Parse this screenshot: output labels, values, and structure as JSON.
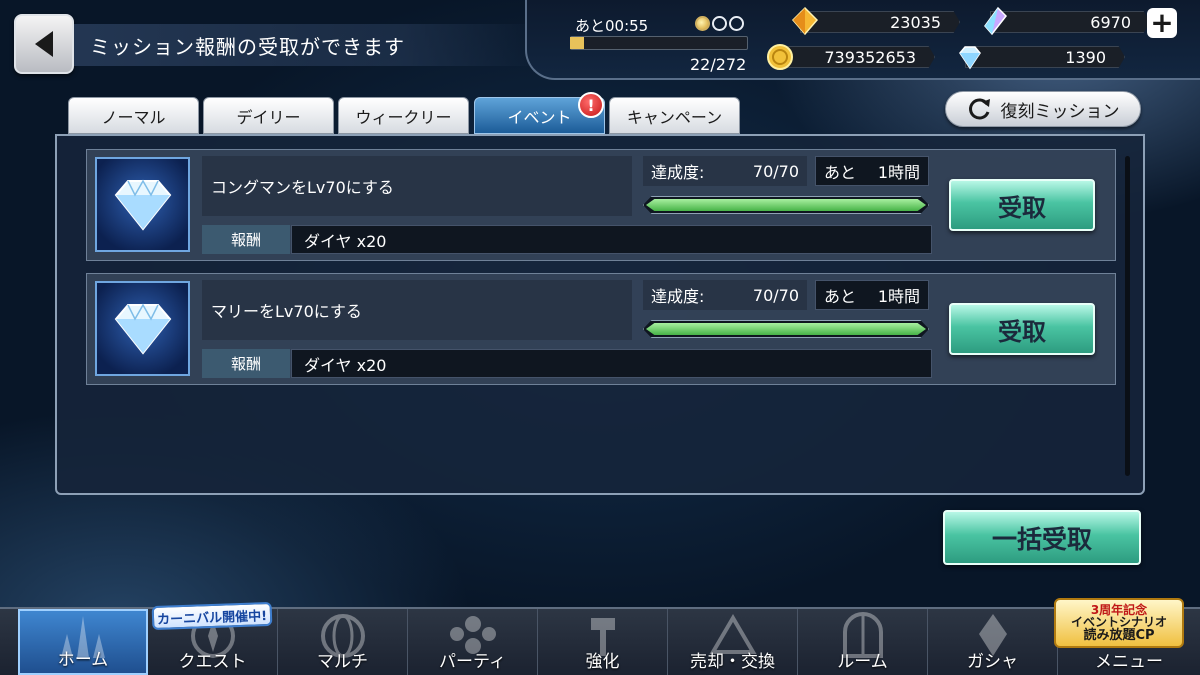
{
  "header": {
    "title": "ミッション報酬の受取ができます",
    "timer": "あと00:55",
    "exp_text": "22/272",
    "currencies": {
      "gold_crystal": "23035",
      "rainbow_crystal": "6970",
      "coins": "739352653",
      "diamonds": "1390"
    },
    "plus_label": "+",
    "exp_progress": 0.081,
    "stamina_orbs": {
      "filled": 1,
      "total": 3
    }
  },
  "tabs": [
    {
      "label": "ノーマル",
      "active": false
    },
    {
      "label": "デイリー",
      "active": false
    },
    {
      "label": "ウィークリー",
      "active": false
    },
    {
      "label": "イベント",
      "active": true
    },
    {
      "label": "キャンペーン",
      "active": false
    }
  ],
  "tab_alert": "!",
  "replay_button": "復刻ミッション",
  "missions": [
    {
      "title": "コングマンをLv70にする",
      "progress_label": "達成度:",
      "progress_value": "70/70",
      "remain_prefix": "あと",
      "remain_value": "1時間",
      "reward_label": "報酬",
      "reward_value": "ダイヤ x20",
      "claim_label": "受取",
      "progress_fraction": 1.0
    },
    {
      "title": "マリーをLv70にする",
      "progress_label": "達成度:",
      "progress_value": "70/70",
      "remain_prefix": "あと",
      "remain_value": "1時間",
      "reward_label": "報酬",
      "reward_value": "ダイヤ x20",
      "claim_label": "受取",
      "progress_fraction": 1.0
    }
  ],
  "claim_all_label": "一括受取",
  "nav": [
    {
      "label": "ホーム",
      "active": true
    },
    {
      "label": "クエスト",
      "active": false
    },
    {
      "label": "マルチ",
      "active": false
    },
    {
      "label": "パーティ",
      "active": false
    },
    {
      "label": "強化",
      "active": false
    },
    {
      "label": "売却・交換",
      "active": false
    },
    {
      "label": "ルーム",
      "active": false
    },
    {
      "label": "ガシャ",
      "active": false
    },
    {
      "label": "メニュー",
      "active": false
    }
  ],
  "carnival_badge": "カーニバル開催中!",
  "anniversary_badge": {
    "line1": "3周年記念",
    "line2": "イベントシナリオ",
    "line3": "読み放題CP"
  },
  "colors": {
    "accent_tab": "#1c5c98",
    "claim_button": "#4ac4a2",
    "progress_fill": "#47b347",
    "alert": "#c41616"
  }
}
